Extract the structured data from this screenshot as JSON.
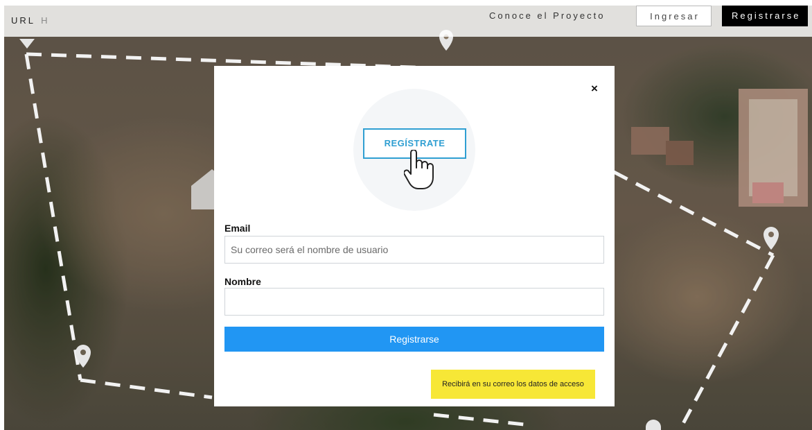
{
  "nav": {
    "brand": "URL",
    "brand_suffix": "H",
    "links": [
      "Conoce el Proyecto",
      "Ingresar",
      "Registrarse"
    ]
  },
  "modal": {
    "close_label": "×",
    "hero_label": "REGÍSTRATE",
    "email": {
      "label": "Email",
      "placeholder": "Su correo será el nombre de usuario",
      "value": ""
    },
    "nombre": {
      "label": "Nombre",
      "placeholder": "",
      "value": ""
    },
    "submit_label": "Registrarse",
    "note": "Recibirá en su correo los datos de acceso"
  },
  "icons": [
    "close-icon",
    "pointing-hand-icon",
    "map-pin-icon"
  ],
  "colors": {
    "accent_blue": "#2196f3",
    "hero_blue": "#2f9fd2",
    "note_yellow": "#f7e736",
    "nav_dark": "#000000"
  }
}
